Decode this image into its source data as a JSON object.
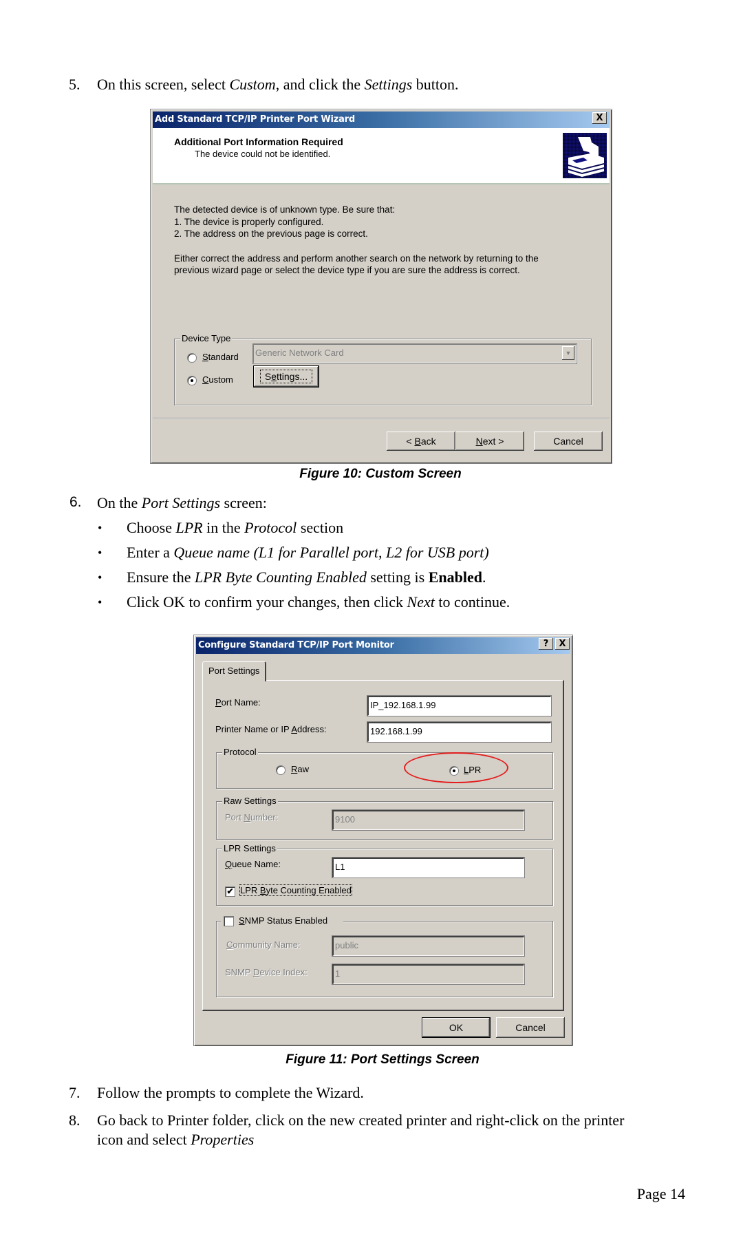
{
  "steps": {
    "step5": {
      "number": "5.",
      "parts": [
        "On this screen, select ",
        "Custom",
        ", and click the ",
        "Settings",
        " button."
      ]
    },
    "step6": {
      "number": "6.",
      "parts": [
        "On the ",
        "Port Settings",
        " screen:"
      ],
      "bullets": [
        {
          "parts": [
            "Choose ",
            "LPR",
            " in the ",
            "Protocol",
            " section"
          ]
        },
        {
          "parts": [
            "Enter a ",
            "Queue name (L1 for Parallel port, L2 for USB port)"
          ]
        },
        {
          "parts": [
            "Ensure the ",
            "LPR Byte Counting Enabled",
            " setting is ",
            "Enabled",
            "."
          ]
        },
        {
          "parts": [
            "Click OK to confirm your changes, then click ",
            "Next",
            " to continue."
          ]
        }
      ]
    },
    "step7": {
      "number": "7.",
      "text": "Follow the prompts to complete the Wizard."
    },
    "step8": {
      "number": "8.",
      "line1": "Go back to Printer folder, click on the new created printer and right-click on the printer",
      "line2_prefix": "icon and select ",
      "line2_italic": "Properties"
    }
  },
  "bullet_char": "•",
  "figure10": {
    "caption": "Figure 10: Custom Screen",
    "dialog": {
      "title": "Add Standard TCP/IP Printer Port Wizard",
      "close_glyph": "X",
      "header_title": "Additional Port Information Required",
      "header_subtitle": "The device could not be identified.",
      "icon": "printer-port-wizard-icon",
      "body_lines": [
        "The detected device is of unknown type.  Be sure that:",
        "1. The device is properly configured.",
        "2.  The address on the previous page is correct."
      ],
      "body_paragraph": [
        "Either correct the address and perform another search on the network by returning to the",
        "previous wizard page or select the device type if you are sure the address is correct."
      ],
      "device_type": {
        "label": "Device Type",
        "standard_label": {
          "accel": "S",
          "rest": "tandard"
        },
        "custom_label": {
          "accel": "C",
          "rest": "ustom"
        },
        "selected": "Custom",
        "standard_combo_value": "Generic Network Card",
        "settings_button": {
          "pre": "S",
          "accel": "e",
          "rest": "ttings..."
        }
      },
      "buttons": {
        "back": {
          "pre": "< ",
          "accel": "B",
          "rest": "ack"
        },
        "next": {
          "accel": "N",
          "rest": "ext >"
        },
        "cancel": "Cancel"
      }
    }
  },
  "figure11": {
    "caption": "Figure 11: Port Settings Screen",
    "dialog": {
      "title": "Configure Standard TCP/IP Port Monitor",
      "help_glyph": "?",
      "close_glyph": "X",
      "tab": "Port Settings",
      "port_name": {
        "accel": "P",
        "rest": "ort Name:",
        "value": "IP_192.168.1.99"
      },
      "ip_address": {
        "pre": "Printer Name or IP ",
        "accel": "A",
        "rest": "ddress:",
        "value": "192.168.1.99"
      },
      "protocol": {
        "label": "Protocol",
        "raw": {
          "accel": "R",
          "rest": "aw"
        },
        "lpr": {
          "accel": "L",
          "rest": "PR"
        },
        "selected": "LPR",
        "highlight_color": "#e41e1e"
      },
      "raw_settings": {
        "label": "Raw Settings",
        "port_number": {
          "pre": "Port ",
          "accel": "N",
          "rest": "umber:",
          "value": "9100"
        }
      },
      "lpr_settings": {
        "label": "LPR Settings",
        "queue_name": {
          "accel": "Q",
          "rest": "ueue Name:",
          "value": "L1"
        },
        "byte_counting": {
          "pre": "LPR ",
          "accel": "B",
          "rest": "yte Counting Enabled",
          "checked": true
        }
      },
      "snmp": {
        "label": {
          "accel": "S",
          "rest": "NMP Status Enabled"
        },
        "checked": false,
        "community_name": {
          "accel": "C",
          "rest": "ommunity Name:",
          "value": "public"
        },
        "device_index": {
          "pre": "SNMP ",
          "accel": "D",
          "rest": "evice Index:",
          "value": "1"
        }
      },
      "buttons": {
        "ok": "OK",
        "cancel": "Cancel"
      }
    }
  },
  "footer": {
    "page": "Page 14"
  },
  "colors": {
    "titlebar_start": "#0a246a",
    "titlebar_end": "#a6caf0",
    "dialog_bg": "#d4d0c8",
    "highlight": "#e41e1e"
  }
}
